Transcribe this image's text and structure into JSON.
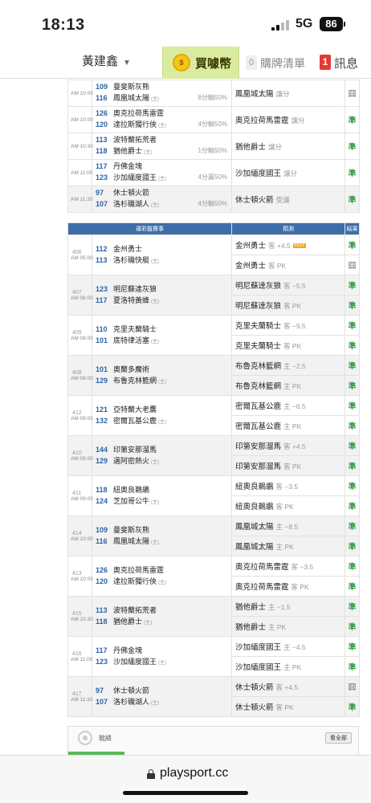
{
  "status": {
    "time": "18:13",
    "network": "5G",
    "battery": "86"
  },
  "nav": {
    "username": "黃建鑫",
    "coin_icon": "coin-icon",
    "buy_label": "買噱幣",
    "list_count": "0",
    "list_label": "購牌清單",
    "msg_count": "1",
    "msg_label": "訊息"
  },
  "top_games": [
    {
      "time": "AM 10:00",
      "n1": "109",
      "t1": "曼斐斯灰熊",
      "n2": "116",
      "t2": "鳳凰城太陽",
      "home": "(主)",
      "note": "8分輸50%",
      "pick": "鳳凰城太陽",
      "pick_sub": "讓分",
      "result": "囧",
      "win": false,
      "bg": "w"
    },
    {
      "time": "AM 10:00",
      "n1": "126",
      "t1": "奧克拉荷馬雷霆",
      "n2": "120",
      "t2": "達拉斯獨行俠",
      "home": "(主)",
      "note": "4分輸50%",
      "pick": "奧克拉荷馬雷霆",
      "pick_sub": "讓分",
      "result": "準",
      "win": true,
      "bg": "w"
    },
    {
      "time": "AM 10:30",
      "n1": "113",
      "t1": "波特蘭拓荒者",
      "n2": "118",
      "t2": "猶他爵士",
      "home": "(主)",
      "note": "1分輸50%",
      "pick": "猶他爵士",
      "pick_sub": "讓分",
      "result": "準",
      "win": true,
      "bg": "w"
    },
    {
      "time": "AM 11:00",
      "n1": "117",
      "t1": "丹佛金塊",
      "n2": "123",
      "t2": "沙加緬度國王",
      "home": "(主)",
      "note": "4分贏50%",
      "pick": "沙加緬度國王",
      "pick_sub": "讓分",
      "result": "準",
      "win": true,
      "bg": "w"
    },
    {
      "time": "AM 11:30",
      "n1": "97",
      "t1": "休士頓火箭",
      "n2": "107",
      "t2": "洛杉磯湖人",
      "home": "(主)",
      "note": "4分輸50%",
      "pick": "休士頓火箭",
      "pick_sub": "受讓",
      "result": "準",
      "win": true,
      "bg": "g"
    }
  ],
  "table_header": {
    "match": "運彩盤賽事",
    "prediction": "預測",
    "result": "結果"
  },
  "games": [
    {
      "id": "406",
      "time": "AM 05:00",
      "n1": "112",
      "t1": "金州勇士",
      "n2": "113",
      "t2": "洛杉磯快艇",
      "home": "(主)",
      "bg": "w",
      "p1": "金州勇士",
      "p1s": "客 +4.5",
      "p1hot": "HOT",
      "r1": "準",
      "r1w": true,
      "p2": "金州勇士",
      "p2s": "客 PK",
      "r2": "囧",
      "r2w": false
    },
    {
      "id": "407",
      "time": "AM 06:00",
      "n1": "123",
      "t1": "明尼蘇達灰狼",
      "n2": "117",
      "t2": "夏洛特黃蜂",
      "home": "(主)",
      "bg": "g",
      "p1": "明尼蘇達灰狼",
      "p1s": "客 −5.5",
      "r1": "準",
      "r1w": true,
      "p2": "明尼蘇達灰狼",
      "p2s": "客 PK",
      "r2": "準",
      "r2w": true
    },
    {
      "id": "409",
      "time": "AM 08:00",
      "n1": "110",
      "t1": "克里夫蘭騎士",
      "n2": "101",
      "t2": "底特律活塞",
      "home": "(主)",
      "bg": "w",
      "p1": "克里夫蘭騎士",
      "p1s": "客 −9.5",
      "r1": "準",
      "r1w": true,
      "p2": "克里夫蘭騎士",
      "p2s": "客 PK",
      "r2": "準",
      "r2w": true
    },
    {
      "id": "408",
      "time": "AM 08:00",
      "n1": "101",
      "t1": "奧蘭多魔術",
      "n2": "129",
      "t2": "布魯克林籃網",
      "home": "(主)",
      "bg": "g",
      "p1": "布魯克林籃網",
      "p1s": "主 −2.5",
      "r1": "準",
      "r1w": true,
      "p2": "布魯克林籃網",
      "p2s": "主 PK",
      "r2": "準",
      "r2w": true
    },
    {
      "id": "412",
      "time": "AM 09:00",
      "n1": "121",
      "t1": "亞特蘭大老鷹",
      "n2": "132",
      "t2": "密爾瓦基公鹿",
      "home": "(主)",
      "bg": "w",
      "p1": "密爾瓦基公鹿",
      "p1s": "主 −6.5",
      "r1": "準",
      "r1w": true,
      "p2": "密爾瓦基公鹿",
      "p2s": "主 PK",
      "r2": "準",
      "r2w": true
    },
    {
      "id": "410",
      "time": "AM 09:00",
      "n1": "144",
      "t1": "印第安那溜馬",
      "n2": "129",
      "t2": "邁阿密熱火",
      "home": "(主)",
      "bg": "g",
      "p1": "印第安那溜馬",
      "p1s": "客 +4.5",
      "r1": "準",
      "r1w": true,
      "p2": "印第安那溜馬",
      "p2s": "客 PK",
      "r2": "準",
      "r2w": true
    },
    {
      "id": "411",
      "time": "AM 09:00",
      "n1": "118",
      "t1": "紐奧良鵜鶘",
      "n2": "124",
      "t2": "芝加哥公牛",
      "home": "(主)",
      "bg": "w",
      "p1": "紐奧良鵜鶘",
      "p1s": "客 −3.5",
      "r1": "準",
      "r1w": true,
      "p2": "紐奧良鵜鶘",
      "p2s": "客 PK",
      "r2": "準",
      "r2w": true
    },
    {
      "id": "414",
      "time": "AM 10:00",
      "n1": "109",
      "t1": "曼斐斯灰熊",
      "n2": "116",
      "t2": "鳳凰城太陽",
      "home": "(主)",
      "bg": "g",
      "p1": "鳳凰城太陽",
      "p1s": "主 −8.5",
      "r1": "準",
      "r1w": true,
      "p2": "鳳凰城太陽",
      "p2s": "主 PK",
      "r2": "準",
      "r2w": true
    },
    {
      "id": "413",
      "time": "AM 10:00",
      "n1": "126",
      "t1": "奧克拉荷馬雷霆",
      "n2": "120",
      "t2": "達拉斯獨行俠",
      "home": "(主)",
      "bg": "w",
      "p1": "奧克拉荷馬雷霆",
      "p1s": "客 −3.5",
      "r1": "準",
      "r1w": true,
      "p2": "奧克拉荷馬雷霆",
      "p2s": "客 PK",
      "r2": "準",
      "r2w": true
    },
    {
      "id": "415",
      "time": "AM 10:30",
      "n1": "113",
      "t1": "波特蘭拓荒者",
      "n2": "118",
      "t2": "猶他爵士",
      "home": "(主)",
      "bg": "g",
      "p1": "猶他爵士",
      "p1s": "主 −1.5",
      "r1": "準",
      "r1w": true,
      "p2": "猶他爵士",
      "p2s": "主 PK",
      "r2": "準",
      "r2w": true
    },
    {
      "id": "416",
      "time": "AM 11:00",
      "n1": "117",
      "t1": "丹佛金塊",
      "n2": "123",
      "t2": "沙加緬度國王",
      "home": "(主)",
      "bg": "w",
      "p1": "沙加緬度國王",
      "p1s": "主 −4.5",
      "r1": "準",
      "r1w": true,
      "p2": "沙加緬度國王",
      "p2s": "主 PK",
      "r2": "準",
      "r2w": true
    },
    {
      "id": "417",
      "time": "AM 11:30",
      "n1": "97",
      "t1": "休士頓火箭",
      "n2": "107",
      "t2": "洛杉磯湖人",
      "home": "(主)",
      "bg": "g",
      "p1": "休士頓火箭",
      "p1s": "客 +4.5",
      "r1": "囧",
      "r1w": false,
      "p2": "休士頓火箭",
      "p2s": "客 PK",
      "r2": "準",
      "r2w": true
    }
  ],
  "stats": {
    "label": "戰績",
    "see_all": "看全部"
  },
  "browser": {
    "url": "playsport.cc"
  }
}
